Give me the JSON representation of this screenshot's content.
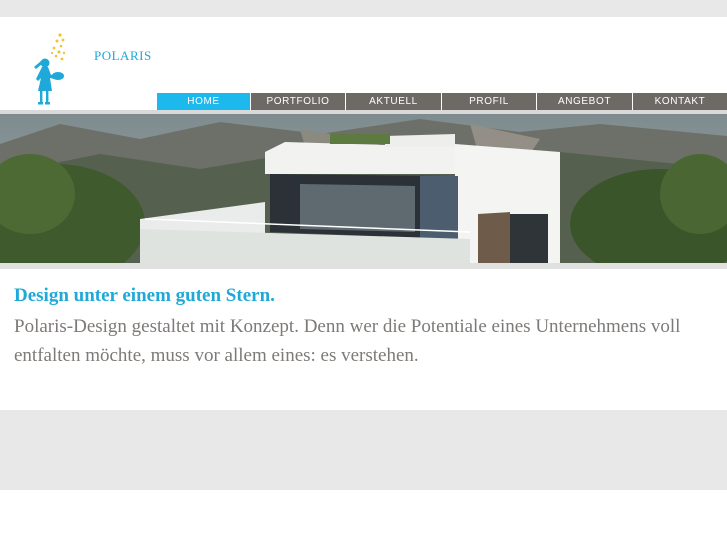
{
  "brand": {
    "name": "POLARIS"
  },
  "nav": {
    "items": [
      {
        "label": "HOME",
        "active": true
      },
      {
        "label": "PORTFOLIO",
        "active": false
      },
      {
        "label": "AKTUELL",
        "active": false
      },
      {
        "label": "PROFIL",
        "active": false
      },
      {
        "label": "ANGEBOT",
        "active": false
      },
      {
        "label": "KONTAKT",
        "active": false
      }
    ]
  },
  "main": {
    "headline": "Design unter einem guten Stern.",
    "body": "Polaris-Design gestaltet mit Konzept. Denn wer die Potentiale eines Unternehmens voll entfalten möchte, muss vor allem eines: es verstehen."
  },
  "colors": {
    "accent": "#1db8ec",
    "nav_bg": "#6d6a66",
    "text_grey": "#7d7a77",
    "band_grey": "#e8e8e8"
  },
  "icons": {
    "logo": "girl-with-stars-logo"
  }
}
